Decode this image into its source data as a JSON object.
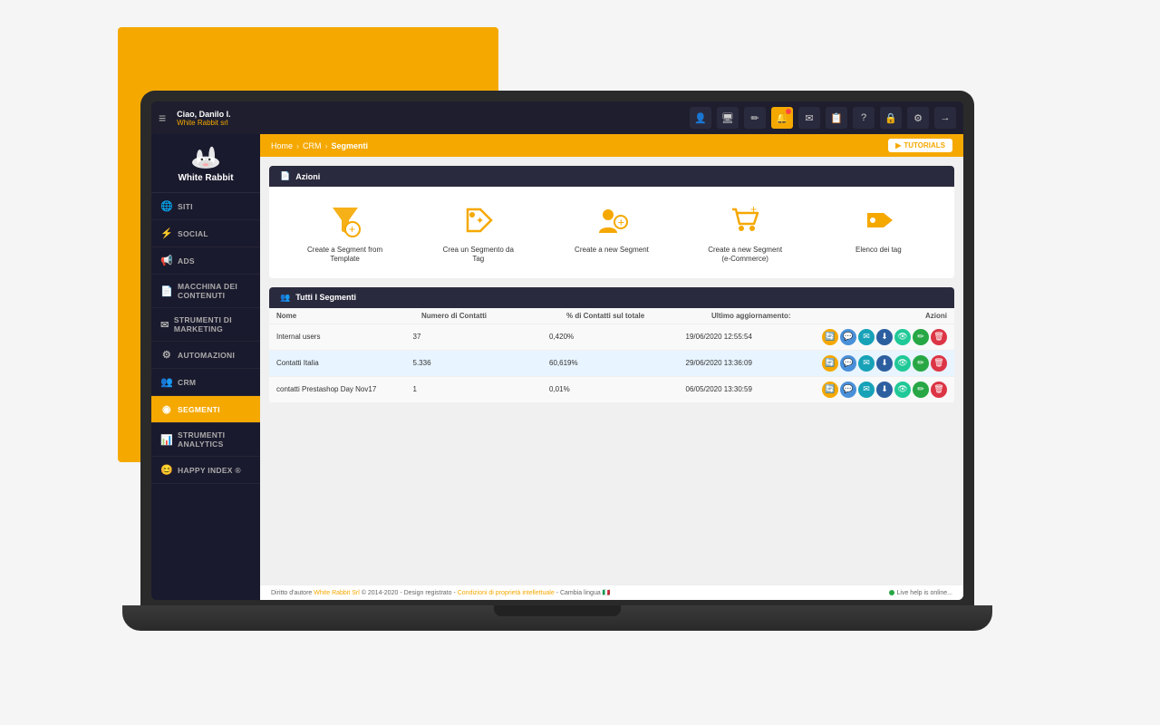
{
  "background": {
    "yellow_color": "#F5A800"
  },
  "topbar": {
    "hamburger": "≡",
    "user_greeting": "Ciao, Danilo I.",
    "company": "White Rabbit srl",
    "icons": [
      "👤",
      "🖥",
      "✏",
      "🔔",
      "✉",
      "📋",
      "❓",
      "🔒",
      "⚙",
      "→"
    ]
  },
  "logo": {
    "text": "White Rabbit"
  },
  "sidebar": {
    "items": [
      {
        "icon": "🌐",
        "label": "SITI",
        "active": false
      },
      {
        "icon": "⚡",
        "label": "SOCIAL",
        "active": false
      },
      {
        "icon": "📢",
        "label": "ADS",
        "active": false
      },
      {
        "icon": "📄",
        "label": "MACCHINA DEI CONTENUTI",
        "active": false
      },
      {
        "icon": "✉",
        "label": "STRUMENTI DI MARKETING",
        "active": false
      },
      {
        "icon": "⚙",
        "label": "AUTOMAZIONI",
        "active": false
      },
      {
        "icon": "👥",
        "label": "CRM",
        "active": false
      },
      {
        "icon": "◉",
        "label": "SEGMENTI",
        "active": true
      },
      {
        "icon": "📊",
        "label": "STRUMENTI ANALYTICS",
        "active": false
      },
      {
        "icon": "😊",
        "label": "HAPPY INDEX ®",
        "active": false
      }
    ]
  },
  "breadcrumb": {
    "home": "Home",
    "crm": "CRM",
    "current": "Segmenti"
  },
  "tutorials_btn": "TUTORIALS",
  "actions_panel": {
    "header": "Azioni",
    "items": [
      {
        "label": "Create a Segment from Template",
        "icon": "filter"
      },
      {
        "label": "Crea un Segmento da Tag",
        "icon": "tag2"
      },
      {
        "label": "Create a new Segment",
        "icon": "users"
      },
      {
        "label": "Create a new Segment (e-Commerce)",
        "icon": "cart"
      },
      {
        "label": "Elenco dei tag",
        "icon": "tag"
      }
    ]
  },
  "segments_panel": {
    "header": "Tutti I Segmenti",
    "columns": [
      "Nome",
      "Numero di Contatti",
      "% di Contatti sul totale",
      "Ultimo aggiornamento:",
      "Azioni"
    ],
    "rows": [
      {
        "name": "Internal users",
        "contacts": "37",
        "percent": "0,420%",
        "updated": "19/06/2020 12:55:54"
      },
      {
        "name": "Contatti Italia",
        "contacts": "5.336",
        "percent": "60,619%",
        "updated": "29/06/2020 13:36:09"
      },
      {
        "name": "contatti Prestashop Day Nov17",
        "contacts": "1",
        "percent": "0,01%",
        "updated": "06/05/2020 13:30:59"
      }
    ]
  },
  "footer": {
    "copyright": "Diritto d'autore ",
    "link_text": "White Rabbit Srl",
    "years": "© 2014-2020",
    "design": " - Design registrato - ",
    "ip_text": "Condizioni di proprietà intellettuale",
    "lang": " - Cambia lingua ",
    "live_chat": "Live help is online..."
  }
}
